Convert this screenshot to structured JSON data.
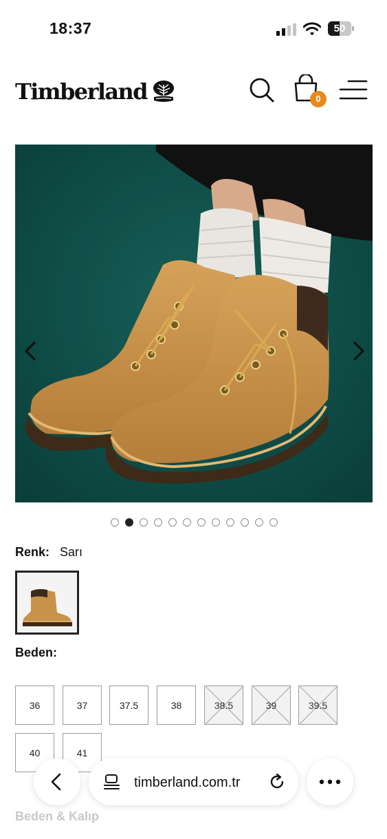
{
  "status_bar": {
    "time": "18:37",
    "battery": "50",
    "battery_level": 0.5
  },
  "header": {
    "brand": "Timberland",
    "cart_count": "0"
  },
  "gallery": {
    "total_images": 12,
    "active_index": 1
  },
  "color": {
    "label": "Renk:",
    "value": "Sarı"
  },
  "size": {
    "title": "Beden:",
    "options": [
      {
        "label": "36",
        "available": true
      },
      {
        "label": "37",
        "available": true
      },
      {
        "label": "37.5",
        "available": true
      },
      {
        "label": "38",
        "available": true
      },
      {
        "label": "38.5",
        "available": false
      },
      {
        "label": "39",
        "available": false
      },
      {
        "label": "39.5",
        "available": false
      },
      {
        "label": "40",
        "available": true
      },
      {
        "label": "41",
        "available": true
      }
    ]
  },
  "fit": {
    "title": "Beden & Kalıp"
  },
  "browser": {
    "url": "timberland.com.tr"
  },
  "colors": {
    "accent": "#e8891d",
    "image_background": "#0f4f4a",
    "boot": "#c8924a"
  }
}
